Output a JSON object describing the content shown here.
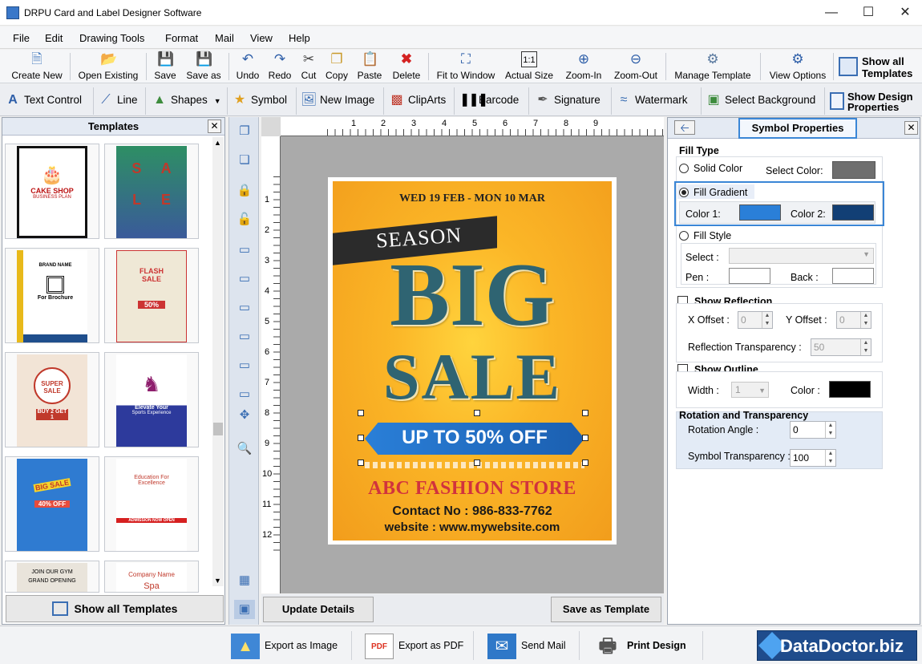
{
  "window": {
    "title": "DRPU Card and Label Designer Software"
  },
  "menu": [
    "File",
    "Edit",
    "Drawing Tools",
    "Format",
    "Mail",
    "View",
    "Help"
  ],
  "toolbar": {
    "create_new": "Create New",
    "open_existing": "Open Existing",
    "save": "Save",
    "save_as": "Save as",
    "undo": "Undo",
    "redo": "Redo",
    "cut": "Cut",
    "copy": "Copy",
    "paste": "Paste",
    "delete": "Delete",
    "fit_to_window": "Fit to Window",
    "actual_size": "Actual Size",
    "zoom_in": "Zoom-In",
    "zoom_out": "Zoom-Out",
    "manage_template": "Manage Template",
    "view_options": "View Options",
    "show_all_templates_1": "Show all",
    "show_all_templates_2": "Templates"
  },
  "drawing_tools": {
    "text_control": "Text Control",
    "line": "Line",
    "shapes": "Shapes",
    "symbol": "Symbol",
    "new_image": "New Image",
    "clip_arts": "ClipArts",
    "barcode": "Barcode",
    "signature": "Signature",
    "watermark": "Watermark",
    "select_background": "Select Background",
    "show_design_properties_1": "Show Design",
    "show_design_properties_2": "Properties"
  },
  "templates_panel": {
    "title": "Templates",
    "show_all_button": "Show all Templates",
    "thumbs": [
      {
        "t1": "CAKE SHOP",
        "t2": "BUSINESS PLAN"
      },
      {
        "t1": "S A",
        "t2": "L E"
      },
      {
        "t1": "BRAND NAME",
        "t2": "For Brochure"
      },
      {
        "t1": "FLASH SALE",
        "t2": "50%"
      },
      {
        "t1": "SUPER SALE",
        "t2": "BUY 2 GET 1"
      },
      {
        "t1": "Elevate Your",
        "t2": "Sports Experience"
      },
      {
        "t1": "BIG SALE",
        "t2": "40% OFF"
      },
      {
        "t1": "Education For Excellence",
        "t2": "ADMISSION NOW OPEN"
      },
      {
        "t1": "JOIN OUR GYM",
        "t2": "GRAND OPENING"
      },
      {
        "t1": "Company Name",
        "t2": "Spa"
      }
    ]
  },
  "rulers": {
    "h": [
      "1",
      "2",
      "3",
      "4",
      "5",
      "6",
      "7",
      "8",
      "9"
    ],
    "v": [
      "1",
      "2",
      "3",
      "4",
      "5",
      "6",
      "7",
      "8",
      "9",
      "10",
      "11",
      "12"
    ]
  },
  "poster": {
    "date": "WED 19 FEB - MON 10 MAR",
    "season": "SEASON",
    "big": "BIG",
    "sale": "SALE",
    "offer": "UP TO 50% OFF",
    "store": "ABC FASHION STORE",
    "contact": "Contact No : 986-833-7762",
    "website": "website :  www.mywebsite.com"
  },
  "canvas_buttons": {
    "update_details": "Update Details",
    "save_as_template": "Save as Template"
  },
  "symbol_properties": {
    "title": "Symbol Properties",
    "fill_type": "Fill Type",
    "solid_color": "Solid Color",
    "select_color": "Select Color:",
    "fill_gradient": "Fill Gradient",
    "color1": "Color 1:",
    "color2": "Color 2:",
    "fill_style": "Fill Style",
    "select": "Select :",
    "pen": "Pen :",
    "back": "Back :",
    "show_reflection": "Show Reflection",
    "x_offset": "X Offset :",
    "x_offset_value": "0",
    "y_offset": "Y Offset :",
    "y_offset_value": "0",
    "reflection_transparency": "Reflection Transparency :",
    "reflection_transparency_value": "50",
    "show_outline": "Show Outline",
    "width": "Width :",
    "width_value": "1",
    "color": "Color :",
    "rotation_header": "Rotation and Transparency",
    "rotation_angle": "Rotation Angle :",
    "rotation_angle_value": "0",
    "symbol_transparency": "Symbol Transparency :",
    "symbol_transparency_value": "100"
  },
  "colors": {
    "solid": "#6e6e6e",
    "gradient1": "#2a7fd8",
    "gradient2": "#123f75",
    "outline": "#000000",
    "highlight": "#3a86d6"
  },
  "bottom_bar": {
    "export_image": "Export as Image",
    "export_pdf": "Export as PDF",
    "send_mail": "Send Mail",
    "print_design": "Print Design",
    "brand": "DataDoctor.biz"
  }
}
